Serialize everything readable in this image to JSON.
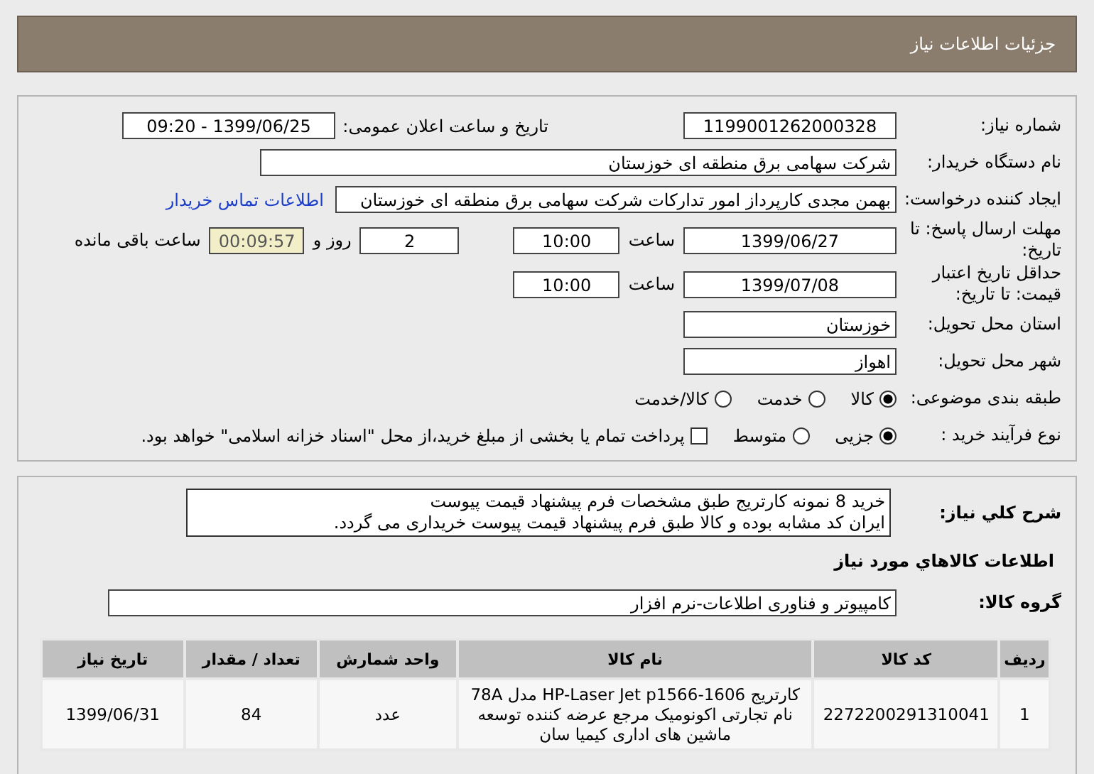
{
  "header": {
    "title": "جزئیات اطلاعات نیاز"
  },
  "need_number": {
    "label": "شماره نیاز:",
    "value": "1199001262000328"
  },
  "announce": {
    "label": "تاریخ و ساعت اعلان عمومی:",
    "value": "1399/06/25 - 09:20"
  },
  "buyer": {
    "label": "نام دستگاه خریدار:",
    "value": "شرکت سهامی برق منطقه ای خوزستان"
  },
  "creator": {
    "label": "ایجاد کننده درخواست:",
    "value": "بهمن مجدی کارپرداز امور تدارکات شرکت سهامی برق منطقه ای خوزستان",
    "link": "اطلاعات تماس خریدار"
  },
  "deadline": {
    "label": "مهلت ارسال پاسخ: تا تاریخ:",
    "date": "1399/06/27",
    "time_label": "ساعت",
    "time": "10:00",
    "days": "2",
    "days_label": "روز و",
    "remaining": "00:09:57",
    "remaining_label": "ساعت باقی مانده"
  },
  "validity": {
    "label": "حداقل تاریخ اعتبار قیمت: تا تاریخ:",
    "date": "1399/07/08",
    "time_label": "ساعت",
    "time": "10:00"
  },
  "province": {
    "label": "استان محل تحویل:",
    "value": "خوزستان"
  },
  "city": {
    "label": "شهر محل تحویل:",
    "value": "اهواز"
  },
  "category": {
    "label": "طبقه بندی موضوعی:",
    "options": [
      {
        "label": "کالا",
        "selected": true
      },
      {
        "label": "خدمت",
        "selected": false
      },
      {
        "label": "کالا/خدمت",
        "selected": false
      }
    ]
  },
  "process": {
    "label": "نوع فرآیند خرید :",
    "options": [
      {
        "label": "جزیی",
        "selected": true
      },
      {
        "label": "متوسط",
        "selected": false
      }
    ],
    "payment": {
      "checked": false,
      "label": "پرداخت تمام یا بخشی از مبلغ خرید،از محل \"اسناد خزانه اسلامی\" خواهد بود."
    }
  },
  "description": {
    "label": "شرح کلي نياز:",
    "lines": [
      "خرید 8 نمونه کارتریج طبق مشخصات فرم پیشنهاد قیمت پیوست",
      "ایران کد مشابه بوده و کالا طبق فرم پیشنهاد قیمت پیوست خریداری می گردد."
    ]
  },
  "goods_title": "اطلاعات کالاهاي مورد نياز",
  "group": {
    "label": "گروه کالا:",
    "value": "کامپیوتر و فناوری اطلاعات-نرم افزار"
  },
  "table": {
    "columns": [
      "ردیف",
      "کد کالا",
      "نام کالا",
      "واحد شمارش",
      "تعداد / مقدار",
      "تاریخ نیاز"
    ],
    "rows": [
      {
        "cells": [
          "1",
          "2272200291310041",
          "کارتریج HP-Laser Jet p1566-1606 مدل 78A نام تجارتی اکونومیک مرجع عرضه کننده توسعه ماشین های اداری کیمیا سان",
          "عدد",
          "84",
          "1399/06/31"
        ]
      }
    ]
  }
}
